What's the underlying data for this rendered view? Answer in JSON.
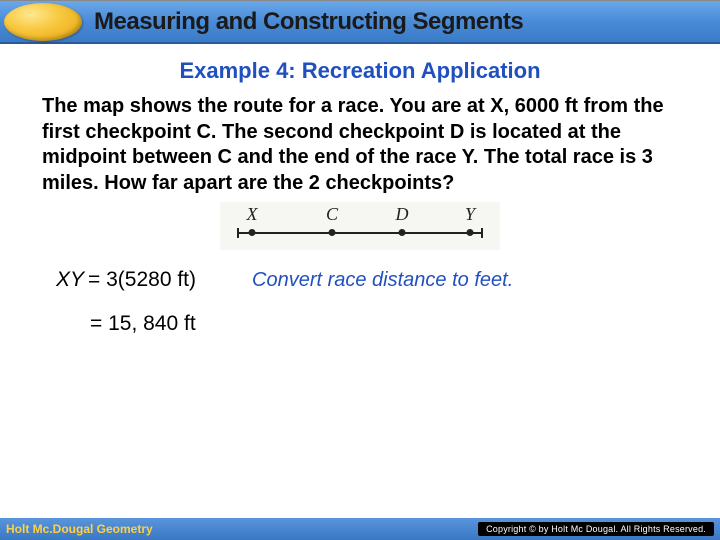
{
  "header": {
    "title": "Measuring and Constructing Segments"
  },
  "example": {
    "title": "Example 4: Recreation Application",
    "problem": "The map shows the route for a race. You are at X, 6000 ft from the first checkpoint C. The second checkpoint D is located at the midpoint between C and the end of the race Y. The total race is 3 miles. How far apart are the 2 checkpoints?"
  },
  "diagram": {
    "points": [
      "X",
      "C",
      "D",
      "Y"
    ]
  },
  "work": {
    "line1_lhs": "XY",
    "line1_rhs": "= 3(5280 ft)",
    "line1_explain": "Convert race distance to feet.",
    "line2": "= 15, 840 ft"
  },
  "footer": {
    "left": "Holt Mc.Dougal Geometry",
    "right": "Copyright © by Holt Mc Dougal. All Rights Reserved."
  }
}
